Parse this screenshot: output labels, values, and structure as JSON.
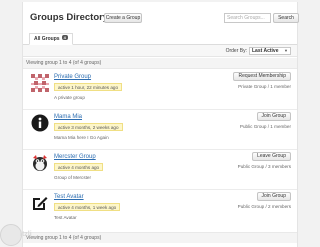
{
  "header": {
    "title": "Groups Directory",
    "create_label": "Create a Group",
    "search_placeholder": "Search Groups...",
    "search_label": "Search"
  },
  "tabs": [
    {
      "label": "All Groups",
      "count": "4"
    }
  ],
  "order": {
    "label": "Order By:",
    "selected": "Last Active"
  },
  "viewing_text": "Viewing group 1 to 4 (of 4 groups)",
  "groups": [
    {
      "name": "Private Group",
      "active": "active 1 hour, 22 minutes ago",
      "description": "A private group",
      "action": "Request Membership",
      "meta": "Private Group / 1 member",
      "avatar": "pink-quilt-pattern"
    },
    {
      "name": "Mama Mia",
      "active": "active 3 months, 2 weeks ago",
      "description": "Mama Mia here I Go Again",
      "action": "Join Group",
      "meta": "Public Group / 1 member",
      "avatar": "info-icon"
    },
    {
      "name": "Mercster Group",
      "active": "active 4 months ago",
      "description": "Group of Mercster",
      "action": "Leave Group",
      "meta": "Public Group / 3 members",
      "avatar": "mascot-image"
    },
    {
      "name": "Test Avatar",
      "active": "active 4 months, 1 week ago",
      "description": "Test Avatar",
      "action": "Join Group",
      "meta": "Public Group / 2 members",
      "avatar": "edit-icon"
    }
  ],
  "watermark": "itzli"
}
